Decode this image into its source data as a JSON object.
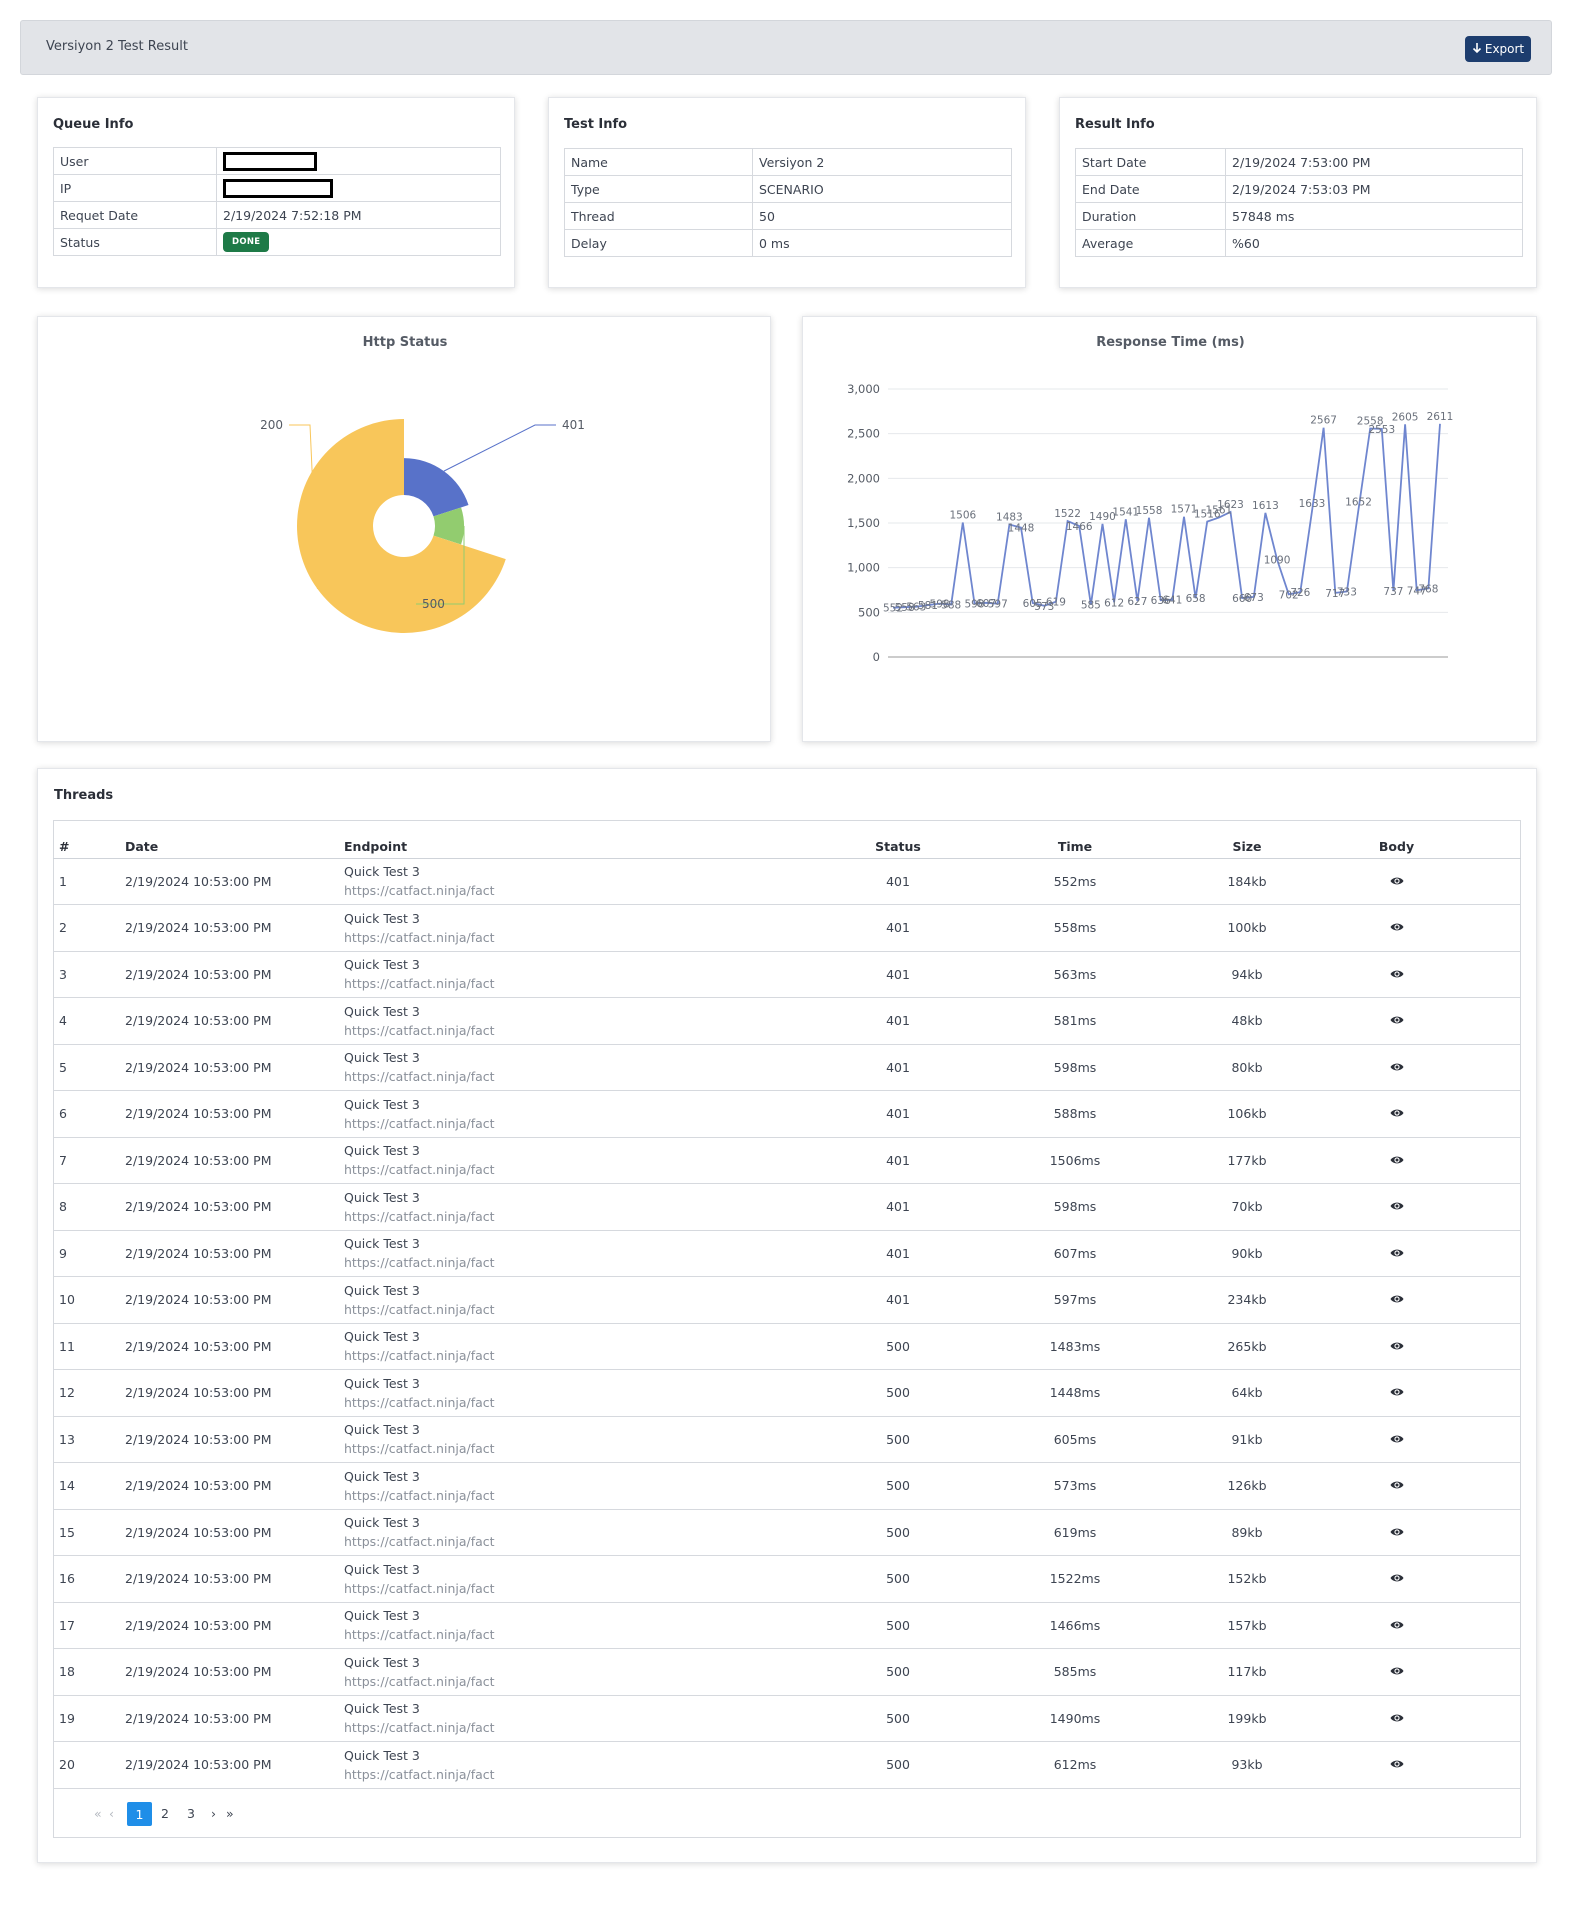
{
  "header": {
    "title": "Versiyon 2 Test Result",
    "export_label": "Export"
  },
  "queue_info": {
    "title": "Queue Info",
    "rows": [
      {
        "label": "User",
        "value": ""
      },
      {
        "label": "IP",
        "value": ""
      },
      {
        "label": "Requet Date",
        "value": "2/19/2024 7:52:18 PM"
      },
      {
        "label": "Status",
        "value": "DONE"
      }
    ]
  },
  "test_info": {
    "title": "Test Info",
    "rows": [
      {
        "label": "Name",
        "value": "Versiyon 2"
      },
      {
        "label": "Type",
        "value": "SCENARIO"
      },
      {
        "label": "Thread",
        "value": "50"
      },
      {
        "label": "Delay",
        "value": "0 ms"
      }
    ]
  },
  "result_info": {
    "title": "Result Info",
    "rows": [
      {
        "label": "Start Date",
        "value": "2/19/2024 7:53:00 PM"
      },
      {
        "label": "End Date",
        "value": "2/19/2024 7:53:03 PM"
      },
      {
        "label": "Duration",
        "value": "57848 ms"
      },
      {
        "label": "Average",
        "value": "%60"
      }
    ]
  },
  "colors": {
    "s200": "#f8c65a",
    "s401": "#5872c9",
    "s500": "#92cc6f",
    "line": "#6f86cf",
    "accent": "#1f8ee8",
    "export": "#1d3d6e",
    "done": "#1e7a47"
  },
  "chart_data": [
    {
      "type": "pie",
      "title": "Http Status",
      "categories": [
        "200",
        "401",
        "500"
      ],
      "values": [
        35,
        10,
        5
      ],
      "style": "nightingale-rose"
    },
    {
      "type": "line",
      "title": "Response Time (ms)",
      "ylim": [
        0,
        3000
      ],
      "yticks": [
        "0",
        "500",
        "1,000",
        "1,500",
        "2,000",
        "2,500",
        "3,000"
      ],
      "grid": true,
      "series": [
        {
          "values": [
            552,
            558,
            563,
            581,
            598,
            588,
            1506,
            598,
            607,
            597,
            1483,
            1448,
            605,
            573,
            619,
            1522,
            1466,
            585,
            1490,
            612,
            1541,
            627,
            1558,
            636,
            641,
            1571,
            658,
            1516,
            1561,
            1623,
            660,
            673,
            1613,
            1090,
            702,
            726,
            1633,
            2567,
            717,
            733,
            1652,
            2558,
            2553,
            737,
            2605,
            747,
            768,
            2611
          ]
        }
      ]
    }
  ],
  "threads": {
    "title": "Threads",
    "columns": [
      "#",
      "Date",
      "Endpoint",
      "Status",
      "Time",
      "Size",
      "Body"
    ],
    "eye_icon": "eye-icon",
    "rows": [
      {
        "num": "1",
        "date": "2/19/2024 10:53:00 PM",
        "ep_name": "Quick Test 3",
        "ep_url": "https://catfact.ninja/fact",
        "status": "401",
        "time": "552ms",
        "size": "184kb"
      },
      {
        "num": "2",
        "date": "2/19/2024 10:53:00 PM",
        "ep_name": "Quick Test 3",
        "ep_url": "https://catfact.ninja/fact",
        "status": "401",
        "time": "558ms",
        "size": "100kb"
      },
      {
        "num": "3",
        "date": "2/19/2024 10:53:00 PM",
        "ep_name": "Quick Test 3",
        "ep_url": "https://catfact.ninja/fact",
        "status": "401",
        "time": "563ms",
        "size": "94kb"
      },
      {
        "num": "4",
        "date": "2/19/2024 10:53:00 PM",
        "ep_name": "Quick Test 3",
        "ep_url": "https://catfact.ninja/fact",
        "status": "401",
        "time": "581ms",
        "size": "48kb"
      },
      {
        "num": "5",
        "date": "2/19/2024 10:53:00 PM",
        "ep_name": "Quick Test 3",
        "ep_url": "https://catfact.ninja/fact",
        "status": "401",
        "time": "598ms",
        "size": "80kb"
      },
      {
        "num": "6",
        "date": "2/19/2024 10:53:00 PM",
        "ep_name": "Quick Test 3",
        "ep_url": "https://catfact.ninja/fact",
        "status": "401",
        "time": "588ms",
        "size": "106kb"
      },
      {
        "num": "7",
        "date": "2/19/2024 10:53:00 PM",
        "ep_name": "Quick Test 3",
        "ep_url": "https://catfact.ninja/fact",
        "status": "401",
        "time": "1506ms",
        "size": "177kb"
      },
      {
        "num": "8",
        "date": "2/19/2024 10:53:00 PM",
        "ep_name": "Quick Test 3",
        "ep_url": "https://catfact.ninja/fact",
        "status": "401",
        "time": "598ms",
        "size": "70kb"
      },
      {
        "num": "9",
        "date": "2/19/2024 10:53:00 PM",
        "ep_name": "Quick Test 3",
        "ep_url": "https://catfact.ninja/fact",
        "status": "401",
        "time": "607ms",
        "size": "90kb"
      },
      {
        "num": "10",
        "date": "2/19/2024 10:53:00 PM",
        "ep_name": "Quick Test 3",
        "ep_url": "https://catfact.ninja/fact",
        "status": "401",
        "time": "597ms",
        "size": "234kb"
      },
      {
        "num": "11",
        "date": "2/19/2024 10:53:00 PM",
        "ep_name": "Quick Test 3",
        "ep_url": "https://catfact.ninja/fact",
        "status": "500",
        "time": "1483ms",
        "size": "265kb"
      },
      {
        "num": "12",
        "date": "2/19/2024 10:53:00 PM",
        "ep_name": "Quick Test 3",
        "ep_url": "https://catfact.ninja/fact",
        "status": "500",
        "time": "1448ms",
        "size": "64kb"
      },
      {
        "num": "13",
        "date": "2/19/2024 10:53:00 PM",
        "ep_name": "Quick Test 3",
        "ep_url": "https://catfact.ninja/fact",
        "status": "500",
        "time": "605ms",
        "size": "91kb"
      },
      {
        "num": "14",
        "date": "2/19/2024 10:53:00 PM",
        "ep_name": "Quick Test 3",
        "ep_url": "https://catfact.ninja/fact",
        "status": "500",
        "time": "573ms",
        "size": "126kb"
      },
      {
        "num": "15",
        "date": "2/19/2024 10:53:00 PM",
        "ep_name": "Quick Test 3",
        "ep_url": "https://catfact.ninja/fact",
        "status": "500",
        "time": "619ms",
        "size": "89kb"
      },
      {
        "num": "16",
        "date": "2/19/2024 10:53:00 PM",
        "ep_name": "Quick Test 3",
        "ep_url": "https://catfact.ninja/fact",
        "status": "500",
        "time": "1522ms",
        "size": "152kb"
      },
      {
        "num": "17",
        "date": "2/19/2024 10:53:00 PM",
        "ep_name": "Quick Test 3",
        "ep_url": "https://catfact.ninja/fact",
        "status": "500",
        "time": "1466ms",
        "size": "157kb"
      },
      {
        "num": "18",
        "date": "2/19/2024 10:53:00 PM",
        "ep_name": "Quick Test 3",
        "ep_url": "https://catfact.ninja/fact",
        "status": "500",
        "time": "585ms",
        "size": "117kb"
      },
      {
        "num": "19",
        "date": "2/19/2024 10:53:00 PM",
        "ep_name": "Quick Test 3",
        "ep_url": "https://catfact.ninja/fact",
        "status": "500",
        "time": "1490ms",
        "size": "199kb"
      },
      {
        "num": "20",
        "date": "2/19/2024 10:53:00 PM",
        "ep_name": "Quick Test 3",
        "ep_url": "https://catfact.ninja/fact",
        "status": "500",
        "time": "612ms",
        "size": "93kb"
      }
    ]
  },
  "pagination": {
    "first": "«",
    "prev": "‹",
    "pages": [
      "1",
      "2",
      "3"
    ],
    "current": "1",
    "next": "›",
    "last": "»"
  }
}
